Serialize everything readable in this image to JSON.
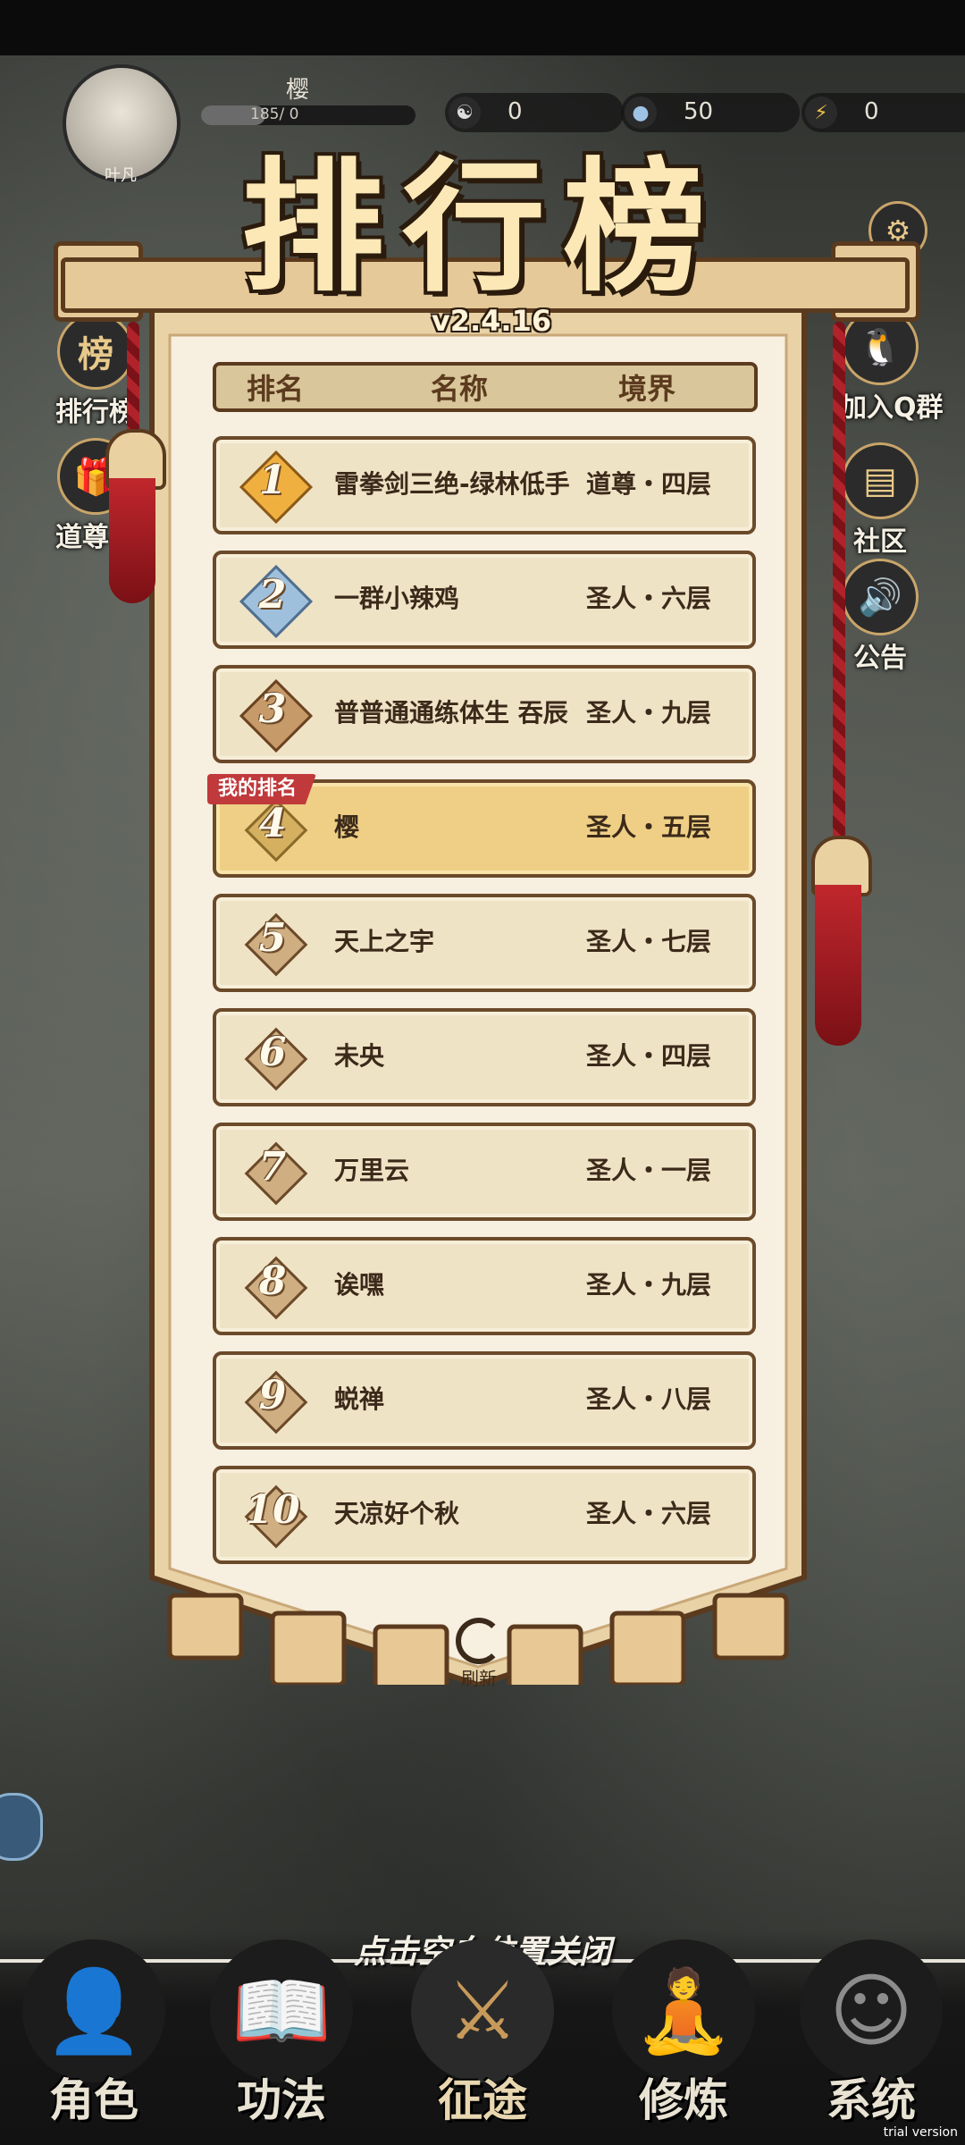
{
  "player": {
    "avatar_label": "叶凡",
    "name": "樱",
    "exp_text": "185/ 0"
  },
  "resources": [
    {
      "icon": "yin-yang-icon",
      "value": "0"
    },
    {
      "icon": "water-drop-icon",
      "value": "50"
    },
    {
      "icon": "lightning-icon",
      "value": "0"
    }
  ],
  "side_left": [
    {
      "icon": "leaderboard-icon",
      "label": "排行榜"
    },
    {
      "icon": "gift-icon",
      "label": "道尊礼包"
    }
  ],
  "side_right": [
    {
      "icon": "qq-penguin-icon",
      "label": "加入Q群"
    },
    {
      "icon": "chat-icon",
      "label": "社区"
    },
    {
      "icon": "speaker-icon",
      "label": "公告"
    }
  ],
  "title": "排行榜",
  "version": "v2.4.16",
  "table": {
    "headers": {
      "rank": "排名",
      "name": "名称",
      "realm": "境界"
    },
    "rows": [
      {
        "rank": "1",
        "name": "雷拳剑三绝-绿林低手",
        "realm": "道尊・四层"
      },
      {
        "rank": "2",
        "name": "一群小辣鸡",
        "realm": "圣人・六层"
      },
      {
        "rank": "3",
        "name": "普普通通练体生 吞辰",
        "realm": "圣人・九层"
      },
      {
        "rank": "4",
        "name": "樱",
        "realm": "圣人・五层"
      },
      {
        "rank": "5",
        "name": "天上之宇",
        "realm": "圣人・七层"
      },
      {
        "rank": "6",
        "name": "未央",
        "realm": "圣人・四层"
      },
      {
        "rank": "7",
        "name": "万里云",
        "realm": "圣人・一层"
      },
      {
        "rank": "8",
        "name": "诶嘿",
        "realm": "圣人・九层"
      },
      {
        "rank": "9",
        "name": "蜕禅",
        "realm": "圣人・八层"
      },
      {
        "rank": "10",
        "name": "天凉好个秋",
        "realm": "圣人・六层"
      }
    ],
    "my_rank_tag": "我的排名"
  },
  "refresh_label": "刷新",
  "close_hint": "点击空白位置关闭",
  "nav": [
    {
      "icon": "character-icon",
      "label": "角色"
    },
    {
      "icon": "book-icon",
      "label": "功法"
    },
    {
      "icon": "sword-icon",
      "label": "征途"
    },
    {
      "icon": "meditation-icon",
      "label": "修炼"
    },
    {
      "icon": "system-icon",
      "label": "系统"
    }
  ],
  "watermark": "trial version",
  "colors": {
    "banner": "#e8d2a6",
    "row": "#efe3c6",
    "my_row": "#efcf85",
    "tag": "#c0393b",
    "tassel": "#b0232b"
  }
}
